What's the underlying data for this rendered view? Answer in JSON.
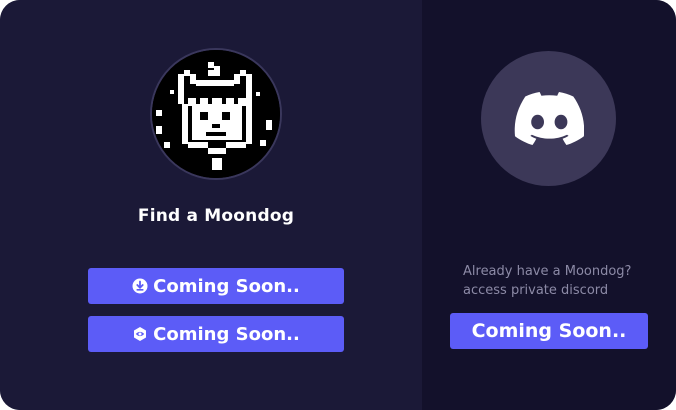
{
  "left_panel": {
    "title": "Find a Moondog",
    "buttons": [
      {
        "label": "Coming Soon..",
        "icon": "download-circle-icon"
      },
      {
        "label": "Coming Soon..",
        "icon": "eye-badge-icon"
      }
    ]
  },
  "right_panel": {
    "icon": "discord-icon",
    "note_line1": "Already have a Moondog?",
    "note_line2": "access private discord",
    "button_label": "Coming Soon.."
  },
  "colors": {
    "left_bg": "#1b1937",
    "right_bg": "#13112b",
    "button": "#5c5cf7",
    "discord_circle": "#3c3858",
    "note_text": "#8c8aa6"
  }
}
